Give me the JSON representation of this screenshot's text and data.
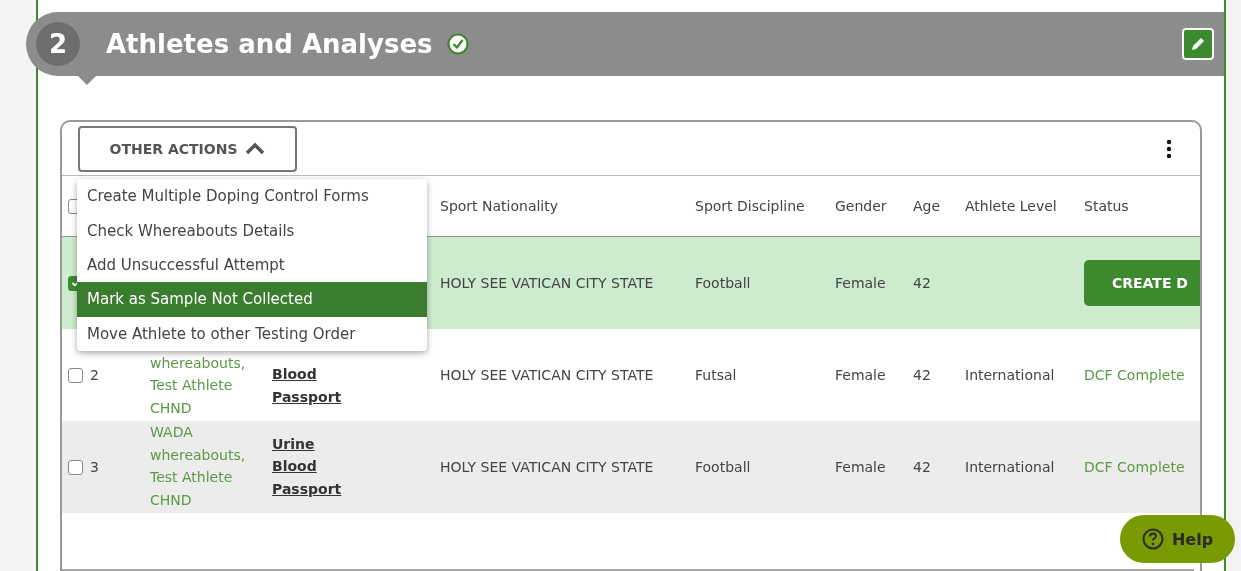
{
  "section": {
    "number": "2",
    "title": "Athletes and Analyses",
    "complete": true
  },
  "toolbar": {
    "actions_button": "OTHER ACTIONS",
    "menu_open": true
  },
  "menu": [
    {
      "label": "Create Multiple Doping Control Forms",
      "selected": false
    },
    {
      "label": "Check Whereabouts Details",
      "selected": false
    },
    {
      "label": "Add Unsuccessful Attempt",
      "selected": false
    },
    {
      "label": "Mark as Sample Not Collected",
      "selected": true
    },
    {
      "label": "Move Athlete to other Testing Order",
      "selected": false
    }
  ],
  "table": {
    "header_checkbox": {
      "checked": false
    },
    "columns": [
      "Sport Nationality",
      "Sport Discipline",
      "Gender",
      "Age",
      "Athlete Level",
      "Status"
    ],
    "rows": [
      {
        "selected": true,
        "checked": true,
        "number": "",
        "athlete": [],
        "analyses": [],
        "nationality": "HOLY SEE VATICAN CITY STATE",
        "discipline": "Football",
        "gender": "Female",
        "age": "42",
        "level": "",
        "status": {
          "kind": "button",
          "text": "CREATE D"
        }
      },
      {
        "selected": false,
        "checked": false,
        "number": "2",
        "athlete": [
          "whereabouts,",
          "Test Athlete",
          "CHND"
        ],
        "analyses": [
          "Blood",
          "Passport"
        ],
        "nationality": "HOLY SEE VATICAN CITY STATE",
        "discipline": "Futsal",
        "gender": "Female",
        "age": "42",
        "level": "International",
        "status": {
          "kind": "text",
          "text": "DCF Complete"
        }
      },
      {
        "selected": false,
        "checked": false,
        "number": "3",
        "athlete": [
          "WADA",
          "whereabouts,",
          "Test Athlete",
          "CHND"
        ],
        "analyses": [
          "Urine",
          "Blood",
          "Passport"
        ],
        "nationality": "HOLY SEE VATICAN CITY STATE",
        "discipline": "Football",
        "gender": "Female",
        "age": "42",
        "level": "International",
        "status": {
          "kind": "text",
          "text": "DCF Complete"
        }
      }
    ]
  },
  "help": "Help"
}
